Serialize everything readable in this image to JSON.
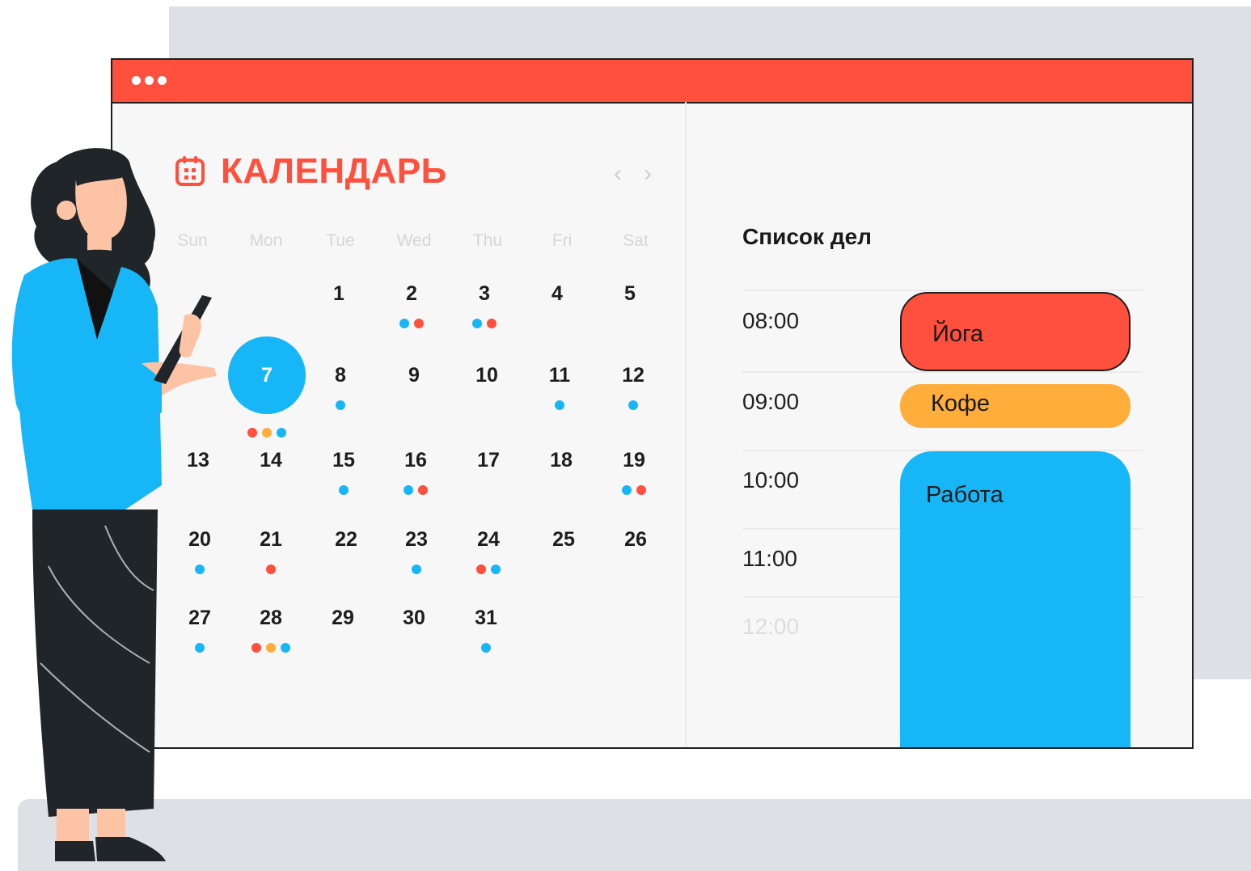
{
  "window": {
    "accent": "#ff4f3d"
  },
  "calendar": {
    "title": "КАЛЕНДАРЬ",
    "icon": "calendar-icon",
    "nav": {
      "prev": "‹",
      "next": "›"
    },
    "weekdays": [
      "Sun",
      "Mon",
      "Tue",
      "Wed",
      "Thu",
      "Fri",
      "Sat"
    ],
    "selected_day": "7",
    "days": [
      {
        "d": "1",
        "dots": []
      },
      {
        "d": "2",
        "dots": [
          "blue",
          "red"
        ]
      },
      {
        "d": "3",
        "dots": [
          "blue",
          "red"
        ]
      },
      {
        "d": "4",
        "dots": []
      },
      {
        "d": "5",
        "dots": []
      },
      {
        "d": "7",
        "dots": [
          "red",
          "orange",
          "blue"
        ]
      },
      {
        "d": "8",
        "dots": [
          "blue"
        ]
      },
      {
        "d": "9",
        "dots": []
      },
      {
        "d": "10",
        "dots": []
      },
      {
        "d": "11",
        "dots": [
          "blue"
        ]
      },
      {
        "d": "12",
        "dots": [
          "blue"
        ]
      },
      {
        "d": "13",
        "dots": []
      },
      {
        "d": "14",
        "dots": []
      },
      {
        "d": "15",
        "dots": [
          "blue"
        ]
      },
      {
        "d": "16",
        "dots": [
          "blue",
          "red"
        ]
      },
      {
        "d": "17",
        "dots": []
      },
      {
        "d": "18",
        "dots": []
      },
      {
        "d": "19",
        "dots": [
          "blue",
          "red"
        ]
      },
      {
        "d": "20",
        "dots": [
          "blue"
        ]
      },
      {
        "d": "21",
        "dots": [
          "red"
        ]
      },
      {
        "d": "22",
        "dots": []
      },
      {
        "d": "23",
        "dots": [
          "blue"
        ]
      },
      {
        "d": "24",
        "dots": [
          "red",
          "blue"
        ]
      },
      {
        "d": "25",
        "dots": []
      },
      {
        "d": "26",
        "dots": []
      },
      {
        "d": "27",
        "dots": [
          "blue"
        ]
      },
      {
        "d": "28",
        "dots": [
          "red",
          "orange",
          "blue"
        ]
      },
      {
        "d": "29",
        "dots": []
      },
      {
        "d": "30",
        "dots": []
      },
      {
        "d": "31",
        "dots": [
          "blue"
        ]
      }
    ]
  },
  "colors": {
    "red": "#ff4f3d",
    "blue": "#17b7f7",
    "orange": "#ffad3b"
  },
  "todo": {
    "title": "Список дел",
    "times": [
      "08:00",
      "09:00",
      "10:00",
      "11:00",
      "12:00"
    ],
    "events": [
      {
        "label": "Йога",
        "color": "#ff4f3d"
      },
      {
        "label": "Кофе",
        "color": "#ffad3b"
      },
      {
        "label": "Работа",
        "color": "#17b7f7"
      }
    ]
  }
}
